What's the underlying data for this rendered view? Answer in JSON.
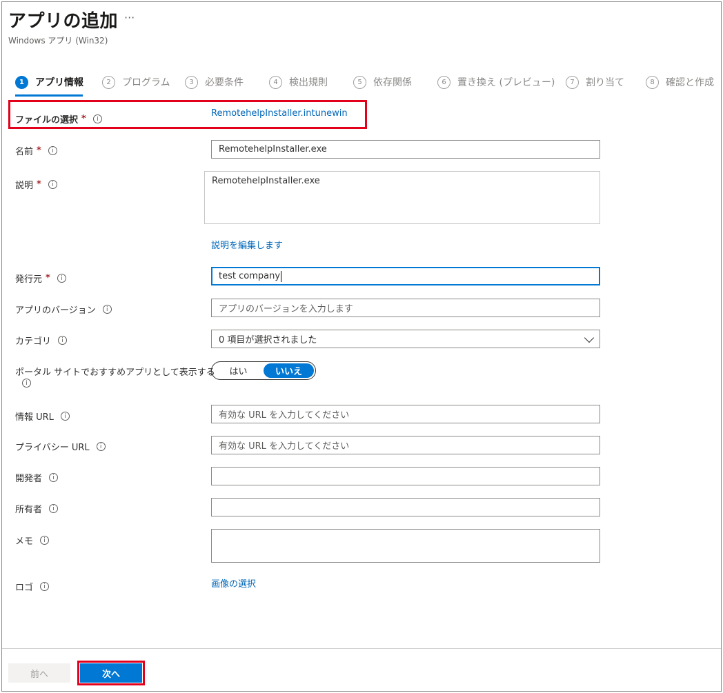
{
  "header": {
    "title": "アプリの追加",
    "more": "···",
    "subtitle": "Windows アプリ (Win32)"
  },
  "steps": [
    {
      "num": "1",
      "label": "アプリ情報",
      "active": true
    },
    {
      "num": "2",
      "label": "プログラム"
    },
    {
      "num": "3",
      "label": "必要条件"
    },
    {
      "num": "4",
      "label": "検出規則"
    },
    {
      "num": "5",
      "label": "依存関係"
    },
    {
      "num": "6",
      "label": "置き換え (プレビュー)"
    },
    {
      "num": "7",
      "label": "割り当て"
    },
    {
      "num": "8",
      "label": "確認と作成"
    }
  ],
  "form": {
    "file": {
      "label": "ファイルの選択",
      "value": "RemotehelpInstaller.intunewin"
    },
    "name": {
      "label": "名前",
      "value": "RemotehelpInstaller.exe"
    },
    "description": {
      "label": "説明",
      "value": "RemotehelpInstaller.exe",
      "edit_link": "説明を編集します"
    },
    "publisher": {
      "label": "発行元",
      "value": "test company"
    },
    "app_version": {
      "label": "アプリのバージョン",
      "placeholder": "アプリのバージョンを入力します"
    },
    "category": {
      "label": "カテゴリ",
      "value": "0 項目が選択されました"
    },
    "featured": {
      "label": "ポータル サイトでおすすめアプリとして表示する",
      "yes": "はい",
      "no": "いいえ",
      "selected": "いいえ"
    },
    "info_url": {
      "label": "情報 URL",
      "placeholder": "有効な URL を入力してください"
    },
    "privacy_url": {
      "label": "プライバシー URL",
      "placeholder": "有効な URL を入力してください"
    },
    "developer": {
      "label": "開発者",
      "value": ""
    },
    "owner": {
      "label": "所有者",
      "value": ""
    },
    "notes": {
      "label": "メモ",
      "value": ""
    },
    "logo": {
      "label": "ロゴ",
      "link": "画像の選択"
    }
  },
  "icons": {
    "required_mark": "*",
    "info": "i",
    "dropdown": "chevron-down-icon"
  },
  "footer": {
    "prev": "前へ",
    "next": "次へ"
  },
  "colors": {
    "accent": "#0078d4",
    "highlight": "#e3001b",
    "link": "#0067b8",
    "required": "#a4262c"
  }
}
